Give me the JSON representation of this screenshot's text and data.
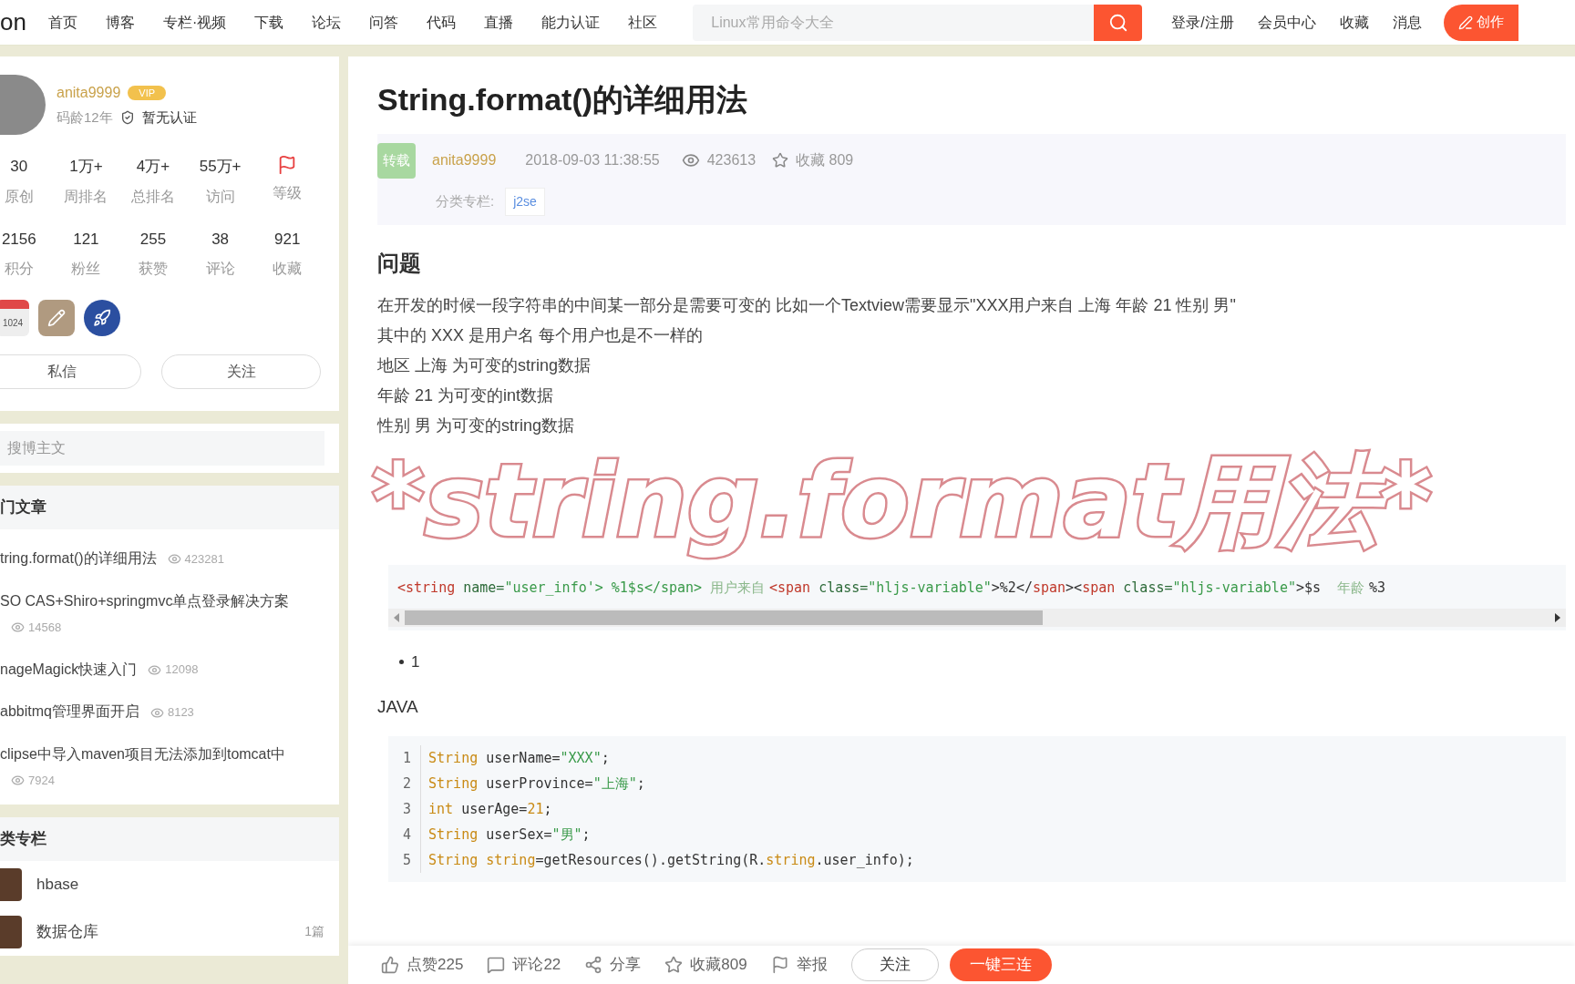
{
  "nav": {
    "logo": "on",
    "items": [
      "首页",
      "博客",
      "专栏·视频",
      "下载",
      "论坛",
      "问答",
      "代码",
      "直播",
      "能力认证",
      "社区"
    ],
    "search": {
      "placeholder": "Linux常用命令大全"
    },
    "links": [
      "登录/注册",
      "会员中心",
      "收藏",
      "消息"
    ],
    "create_button": "创作"
  },
  "profile": {
    "name": "anita9999",
    "vip": "VIP",
    "age": "码龄12年",
    "cert": "暂无认证",
    "stats": [
      {
        "value": "30",
        "label": "原创"
      },
      {
        "value": "1万+",
        "label": "周排名"
      },
      {
        "value": "4万+",
        "label": "总排名"
      },
      {
        "value": "55万+",
        "label": "访问"
      },
      {
        "kind": "icon",
        "label": "等级"
      }
    ],
    "stats2": [
      {
        "value": "2156",
        "label": "积分"
      },
      {
        "value": "121",
        "label": "粉丝"
      },
      {
        "value": "255",
        "label": "获赞"
      },
      {
        "value": "38",
        "label": "评论"
      },
      {
        "value": "921",
        "label": "收藏"
      }
    ],
    "badges": [
      {
        "kind": "calendar",
        "text": "1024"
      },
      {
        "kind": "pencil"
      },
      {
        "kind": "rocket"
      }
    ],
    "buttons": [
      "私信",
      "关注"
    ]
  },
  "sidebar_search": {
    "placeholder": "搜博主文"
  },
  "hot": {
    "title": "门文章",
    "items": [
      {
        "title": "tring.format()的详细用法",
        "views": "423281"
      },
      {
        "title": "SO CAS+Shiro+springmvc单点登录解决方案",
        "views": "14568"
      },
      {
        "title": "nageMagick快速入门",
        "views": "12098"
      },
      {
        "title": "abbitmq管理界面开启",
        "views": "8123"
      },
      {
        "title": "clipse中导入maven项目无法添加到tomcat中",
        "views": "7924"
      }
    ]
  },
  "categories": {
    "title": "类专栏",
    "items": [
      {
        "name": "hbase"
      },
      {
        "name": "数据仓库",
        "count": "1篇"
      }
    ]
  },
  "article": {
    "title": "String.format()的详细用法",
    "tag": "转载",
    "author": "anita9999",
    "date": "2018-09-03 11:38:55",
    "views": "423613",
    "favorites": "收藏 809",
    "category_label": "分类专栏:",
    "category": "j2se",
    "heading": "问题",
    "paragraphs": [
      "在开发的时候一段字符串的中间某一部分是需要可变的 比如一个Textview需要显示\"XXX用户来自 上海 年龄 21 性别 男\"",
      "其中的 XXX 是用户名 每个用户也是不一样的",
      "地区 上海 为可变的string数据",
      "年龄 21 为可变的int数据",
      "性别 男 为可变的string数据"
    ],
    "code1": [
      {
        "kind": "tag",
        "text": "<string"
      },
      {
        "kind": "attr",
        "text": " name="
      },
      {
        "kind": "string",
        "text": "\"user_info'> %1$s</span> "
      },
      {
        "kind": "cjk",
        "text": "用户来自 "
      },
      {
        "kind": "tag",
        "text": "<span"
      },
      {
        "kind": "attr",
        "text": " class="
      },
      {
        "kind": "string",
        "text": "\"hljs-variable\""
      },
      {
        "kind": "plain",
        "text": ">%2</"
      },
      {
        "kind": "tag",
        "text": "span"
      },
      {
        "kind": "plain",
        "text": "><"
      },
      {
        "kind": "tag",
        "text": "span"
      },
      {
        "kind": "attr",
        "text": " class="
      },
      {
        "kind": "string",
        "text": "\"hljs-variable\""
      },
      {
        "kind": "plain",
        "text": ">$s  "
      },
      {
        "kind": "cjk",
        "text": "年龄 "
      },
      {
        "kind": "plain",
        "text": "%3"
      }
    ],
    "list_item": "1",
    "lang": "JAVA",
    "code2": [
      {
        "num": "1",
        "tokens": [
          {
            "kind": "type",
            "text": "String"
          },
          {
            "kind": "plain",
            "text": " userName="
          },
          {
            "kind": "string",
            "text": "\"XXX\""
          },
          {
            "kind": "plain",
            "text": ";"
          }
        ]
      },
      {
        "num": "2",
        "tokens": [
          {
            "kind": "type",
            "text": "String"
          },
          {
            "kind": "plain",
            "text": " userProvince="
          },
          {
            "kind": "string",
            "text": "\"上海\""
          },
          {
            "kind": "plain",
            "text": ";"
          }
        ]
      },
      {
        "num": "3",
        "tokens": [
          {
            "kind": "type",
            "text": "int"
          },
          {
            "kind": "plain",
            "text": " userAge="
          },
          {
            "kind": "number",
            "text": "21"
          },
          {
            "kind": "plain",
            "text": ";"
          }
        ]
      },
      {
        "num": "4",
        "tokens": [
          {
            "kind": "type",
            "text": "String"
          },
          {
            "kind": "plain",
            "text": " userSex="
          },
          {
            "kind": "string",
            "text": "\"男\""
          },
          {
            "kind": "plain",
            "text": ";"
          }
        ]
      },
      {
        "num": "5",
        "tokens": [
          {
            "kind": "type",
            "text": "String string"
          },
          {
            "kind": "plain",
            "text": "=getResources().getString(R."
          },
          {
            "kind": "type",
            "text": "string"
          },
          {
            "kind": "plain",
            "text": ".user_info);"
          }
        ]
      }
    ]
  },
  "toolbar": [
    {
      "kind": "like",
      "label": "点赞225"
    },
    {
      "kind": "comment",
      "label": "评论22"
    },
    {
      "kind": "share",
      "label": "分享"
    },
    {
      "kind": "star",
      "label": "收藏809"
    },
    {
      "kind": "flag",
      "label": "举报"
    },
    {
      "kind": "outline",
      "label": "关注"
    },
    {
      "kind": "primary",
      "label": "一键三连"
    }
  ],
  "caption": "*string.format用法*"
}
